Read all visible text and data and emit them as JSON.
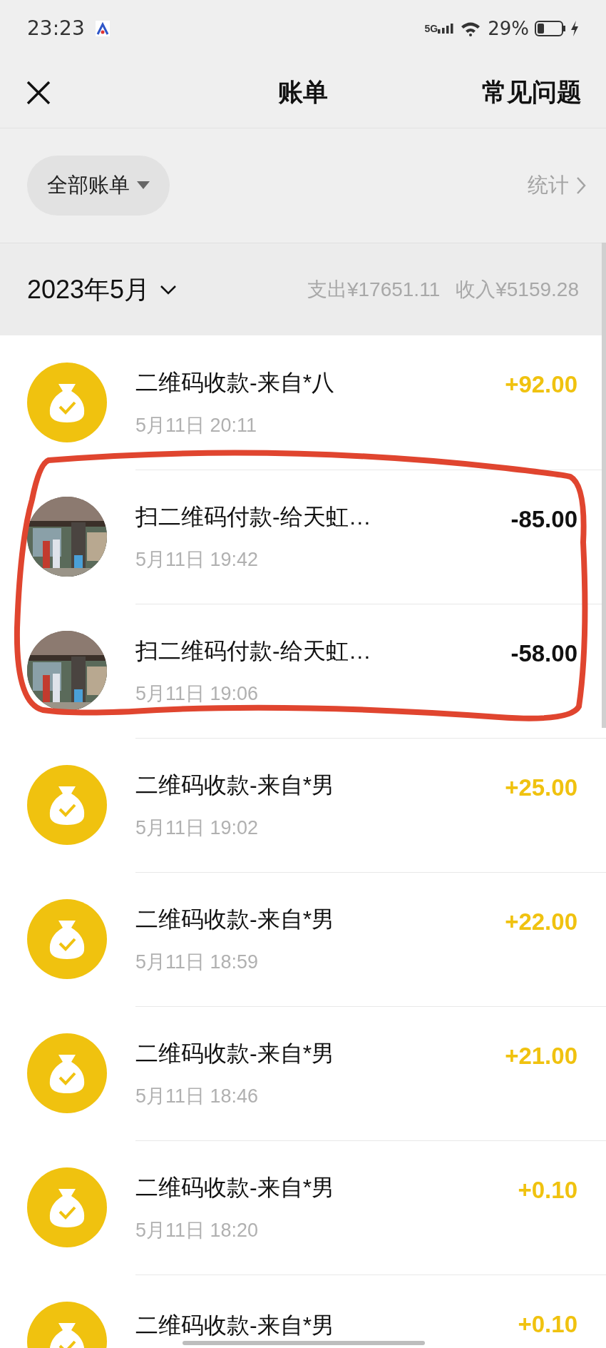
{
  "status_bar": {
    "time": "23:23",
    "network": "5G",
    "battery": "29%"
  },
  "header": {
    "title": "账单",
    "help": "常见问题"
  },
  "filter": {
    "label": "全部账单",
    "stats": "统计"
  },
  "month": {
    "label": "2023年5月",
    "expense": "支出¥17651.11",
    "income": "收入¥5159.28"
  },
  "rows": [
    {
      "kind": "income",
      "title": "二维码收款-来自*八",
      "time": "5月11日 20:11",
      "amount": "+92.00"
    },
    {
      "kind": "payment",
      "title": "扫二维码付款-给天虹…",
      "time": "5月11日 19:42",
      "amount": "-85.00"
    },
    {
      "kind": "payment",
      "title": "扫二维码付款-给天虹…",
      "time": "5月11日 19:06",
      "amount": "-58.00"
    },
    {
      "kind": "income",
      "title": "二维码收款-来自*男",
      "time": "5月11日 19:02",
      "amount": "+25.00"
    },
    {
      "kind": "income",
      "title": "二维码收款-来自*男",
      "time": "5月11日 18:59",
      "amount": "+22.00"
    },
    {
      "kind": "income",
      "title": "二维码收款-来自*男",
      "time": "5月11日 18:46",
      "amount": "+21.00"
    },
    {
      "kind": "income",
      "title": "二维码收款-来自*男",
      "time": "5月11日 18:20",
      "amount": "+0.10"
    },
    {
      "kind": "income",
      "title": "二维码收款-来自*男",
      "amount": "+0.10"
    }
  ]
}
